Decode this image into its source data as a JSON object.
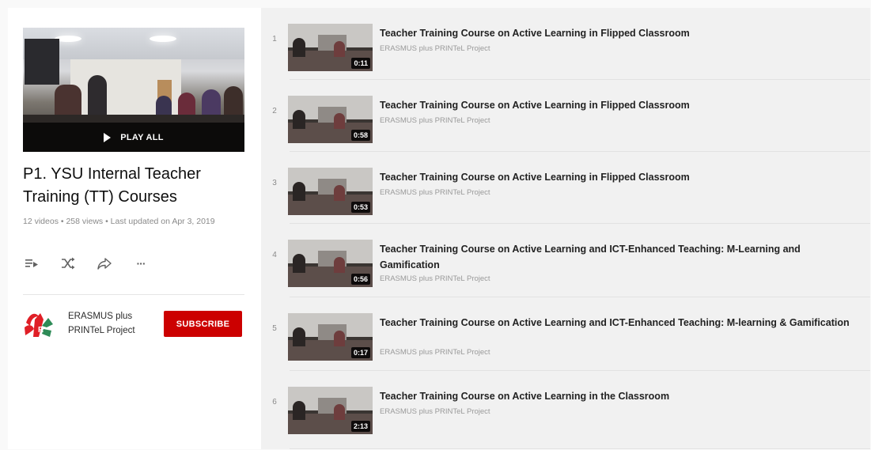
{
  "playlist": {
    "play_all_label": "PLAY ALL",
    "title": "P1. YSU Internal Teacher Training (TT) Courses",
    "meta": "12 videos • 258 views • Last updated on Apr 3, 2019",
    "actions": [
      {
        "icon": "add-to-queue-icon"
      },
      {
        "icon": "shuffle-icon"
      },
      {
        "icon": "share-icon"
      },
      {
        "icon": "more-icon",
        "glyph": "···"
      }
    ]
  },
  "owner": {
    "name": "ERASMUS plus PRINTeL Project",
    "subscribe_label": "SUBSCRIBE",
    "avatar_text": "IAR",
    "colors": {
      "avatar_red": "#e01f26",
      "avatar_green": "#2e8b57",
      "subscribe": "#cc0000"
    }
  },
  "videos": [
    {
      "index": "1",
      "title": "Teacher Training Course on Active Learning in Flipped Classroom",
      "channel": "ERASMUS plus PRINTeL Project",
      "duration": "0:11"
    },
    {
      "index": "2",
      "title": "Teacher Training Course on Active Learning in Flipped Classroom",
      "channel": "ERASMUS plus PRINTeL Project",
      "duration": "0:58"
    },
    {
      "index": "3",
      "title": "Teacher Training Course on Active Learning in Flipped Classroom",
      "channel": "ERASMUS plus PRINTeL Project",
      "duration": "0:53"
    },
    {
      "index": "4",
      "title": "Teacher Training Course on Active Learning and ICT-Enhanced Teaching: M-Learning and Gamification",
      "channel": "ERASMUS plus PRINTeL Project",
      "duration": "0:56"
    },
    {
      "index": "5",
      "title": "Teacher Training Course on Active Learning and ICT-Enhanced Teaching: M-learning & Gamification",
      "channel": "ERASMUS plus PRINTeL Project",
      "duration": "0:17"
    },
    {
      "index": "6",
      "title": "Teacher Training Course on Active Learning in the Classroom",
      "channel": "ERASMUS plus PRINTeL Project",
      "duration": "2:13"
    }
  ]
}
